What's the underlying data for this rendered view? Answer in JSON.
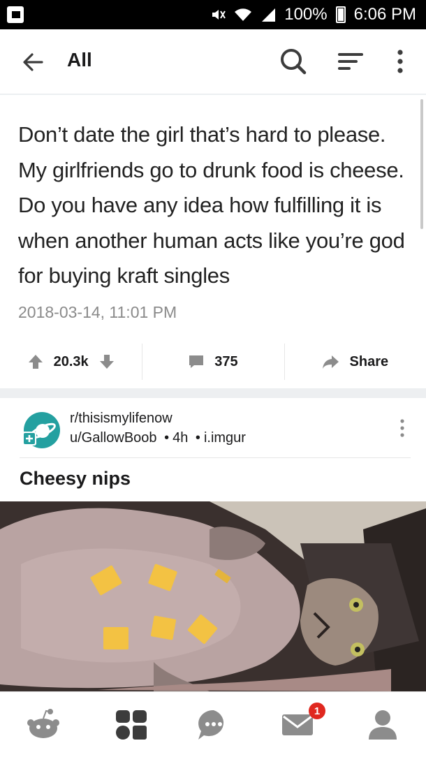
{
  "status_bar": {
    "battery": "100%",
    "time": "6:06 PM"
  },
  "app_bar": {
    "title": "All",
    "icons": [
      "back-arrow-icon",
      "search-icon",
      "sort-icon",
      "more-vertical-icon"
    ]
  },
  "text_post": {
    "body": "Don’t date the girl that’s hard to please. My girlfriends go to drunk food is cheese. Do you have any idea how fulfilling it is when another human acts like you’re god for buying kraft singles",
    "date": "2018-03-14, 11:01 PM",
    "votes": "20.3k",
    "comments": "375",
    "share_label": "Share"
  },
  "post": {
    "subreddit": "r/thisismylifenow",
    "user": "u/GallowBoob",
    "age": "4h",
    "domain": "i.imgur",
    "separator": "•",
    "title": "Cheesy nips"
  },
  "bottom_nav": {
    "items": [
      "home-icon",
      "communities-icon",
      "chat-icon",
      "inbox-icon",
      "account-icon"
    ],
    "inbox_badge": "1"
  },
  "colors": {
    "accent_teal": "#24a0a0",
    "badge_red": "#e0281f",
    "icon_gray": "#8c8c8c"
  }
}
